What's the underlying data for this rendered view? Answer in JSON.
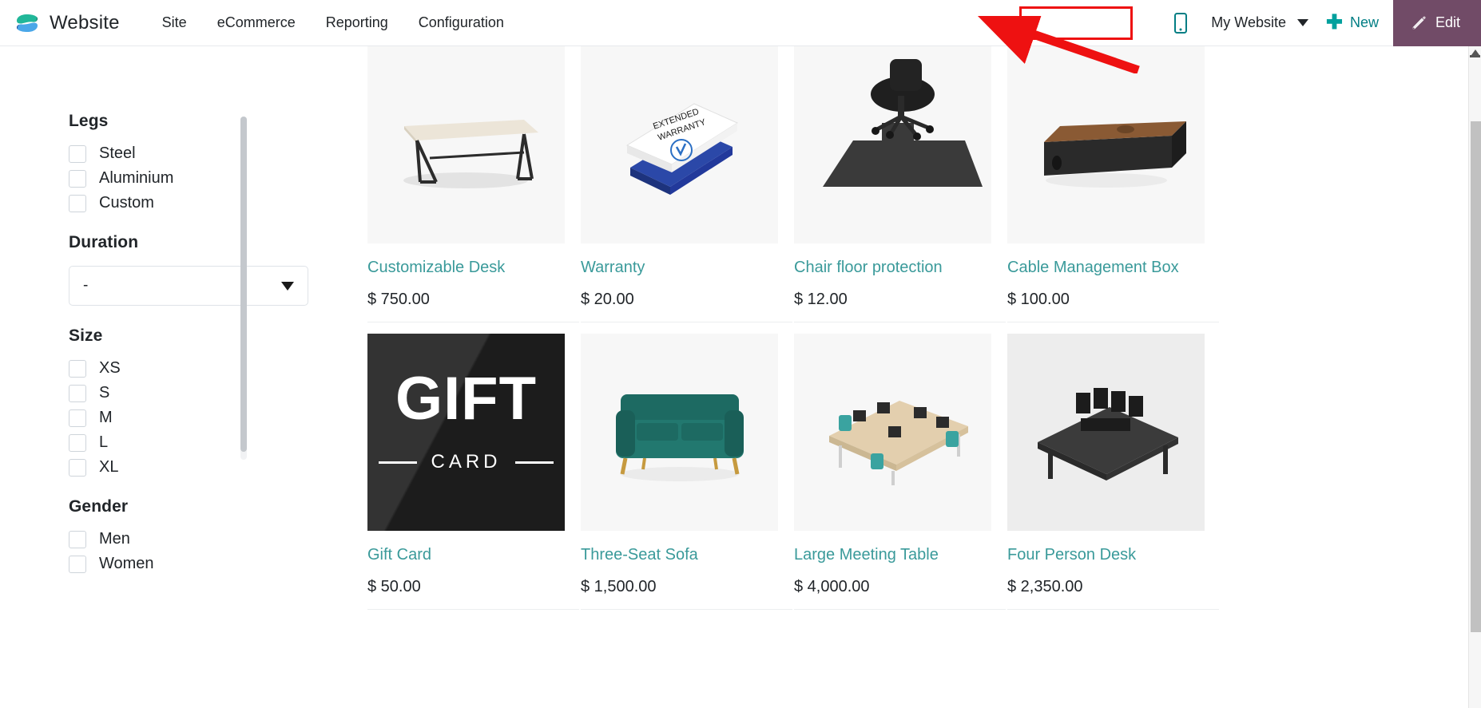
{
  "navbar": {
    "brand": "Website",
    "menu": [
      {
        "label": "Site"
      },
      {
        "label": "eCommerce"
      },
      {
        "label": "Reporting"
      },
      {
        "label": "Configuration"
      }
    ],
    "mobile_preview_icon": "mobile-phone-icon",
    "website_selector": {
      "label": "My Website",
      "caret_icon": "chevron-down-icon",
      "highlighted": true,
      "highlight_color": "#ee1111"
    },
    "new_button": {
      "label": "New",
      "icon": "plus-icon"
    },
    "edit_button": {
      "label": "Edit",
      "icon": "pencil-icon",
      "background": "#714b67"
    }
  },
  "annotation": {
    "arrow_color": "#ee1111",
    "target": "My Website"
  },
  "sidebar": {
    "groups": [
      {
        "title": "Legs",
        "type": "checkbox",
        "options": [
          {
            "label": "Steel",
            "checked": false
          },
          {
            "label": "Aluminium",
            "checked": false
          },
          {
            "label": "Custom",
            "checked": false
          }
        ]
      },
      {
        "title": "Duration",
        "type": "select",
        "selected": "-",
        "caret_icon": "chevron-down-icon"
      },
      {
        "title": "Size",
        "type": "checkbox",
        "options": [
          {
            "label": "XS",
            "checked": false
          },
          {
            "label": "S",
            "checked": false
          },
          {
            "label": "M",
            "checked": false
          },
          {
            "label": "L",
            "checked": false
          },
          {
            "label": "XL",
            "checked": false
          }
        ]
      },
      {
        "title": "Gender",
        "type": "checkbox",
        "options": [
          {
            "label": "Men",
            "checked": false
          },
          {
            "label": "Women",
            "checked": false
          }
        ]
      }
    ]
  },
  "products": [
    {
      "name": "Customizable Desk",
      "price": "$ 750.00",
      "art": "desk"
    },
    {
      "name": "Warranty",
      "price": "$ 20.00",
      "art": "warranty"
    },
    {
      "name": "Chair floor protection",
      "price": "$ 12.00",
      "art": "floormat"
    },
    {
      "name": "Cable Management Box",
      "price": "$ 100.00",
      "art": "cablebox"
    },
    {
      "name": "Gift Card",
      "price": "$ 50.00",
      "art": "giftcard",
      "card_title": "GIFT",
      "card_sub": "CARD"
    },
    {
      "name": "Three-Seat Sofa",
      "price": "$ 1,500.00",
      "art": "sofa"
    },
    {
      "name": "Large Meeting Table",
      "price": "$ 4,000.00",
      "art": "meetingtable"
    },
    {
      "name": "Four Person Desk",
      "price": "$ 2,350.00",
      "art": "fourdesk"
    }
  ],
  "colors": {
    "accent_teal": "#3a9a9a",
    "link_teal": "#017e84",
    "edit_purple": "#714b67",
    "annotation_red": "#ee1111"
  }
}
